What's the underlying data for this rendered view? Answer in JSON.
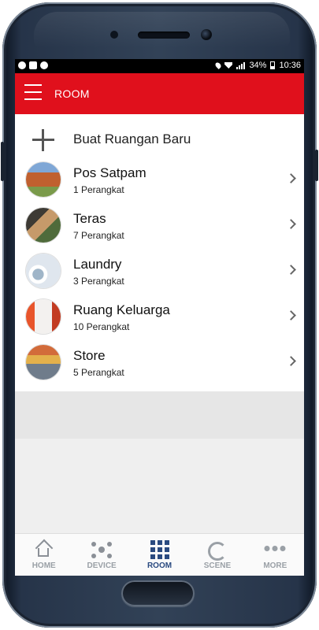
{
  "status_bar": {
    "battery": "34%",
    "time": "10:36",
    "left_icons": [
      "whatsapp-icon",
      "mail-icon",
      "messenger-icon"
    ],
    "right_icons": [
      "location-icon",
      "wifi-icon",
      "signal-icon",
      "battery-icon"
    ]
  },
  "app_bar": {
    "title": "ROOM",
    "menu_icon": "hamburger-icon",
    "color": "#e0101c"
  },
  "add_room": {
    "label": "Buat Ruangan Baru",
    "icon": "plus-icon"
  },
  "rooms": [
    {
      "name": "Pos Satpam",
      "count": "1 Perangkat",
      "thumb_colors": [
        "#c0602f",
        "#7a9a4a",
        "#5b7fae"
      ]
    },
    {
      "name": "Teras",
      "count": "7 Perangkat",
      "thumb_colors": [
        "#4f6b3b",
        "#c69a6a",
        "#3d3a34"
      ]
    },
    {
      "name": "Laundry",
      "count": "3 Perangkat",
      "thumb_colors": [
        "#dfe6ee",
        "#9fb5c8",
        "#ffffff"
      ]
    },
    {
      "name": "Ruang Keluarga",
      "count": "10 Perangkat",
      "thumb_colors": [
        "#e8552b",
        "#f3f1ef",
        "#c23b22"
      ]
    },
    {
      "name": "Store",
      "count": "5 Perangkat",
      "thumb_colors": [
        "#d26b3a",
        "#6f7c8b",
        "#e3b04b"
      ]
    }
  ],
  "bottom_nav": [
    {
      "label": "HOME",
      "icon": "home-icon",
      "active": false
    },
    {
      "label": "DEVICE",
      "icon": "device-network-icon",
      "active": false
    },
    {
      "label": "ROOM",
      "icon": "room-grid-icon",
      "active": true
    },
    {
      "label": "SCENE",
      "icon": "scene-refresh-icon",
      "active": false
    },
    {
      "label": "MORE",
      "icon": "more-dots-icon",
      "active": false
    }
  ],
  "colors": {
    "accent": "#e0101c",
    "active_nav": "#2a4a80",
    "inactive_nav": "#9aa0a6"
  }
}
